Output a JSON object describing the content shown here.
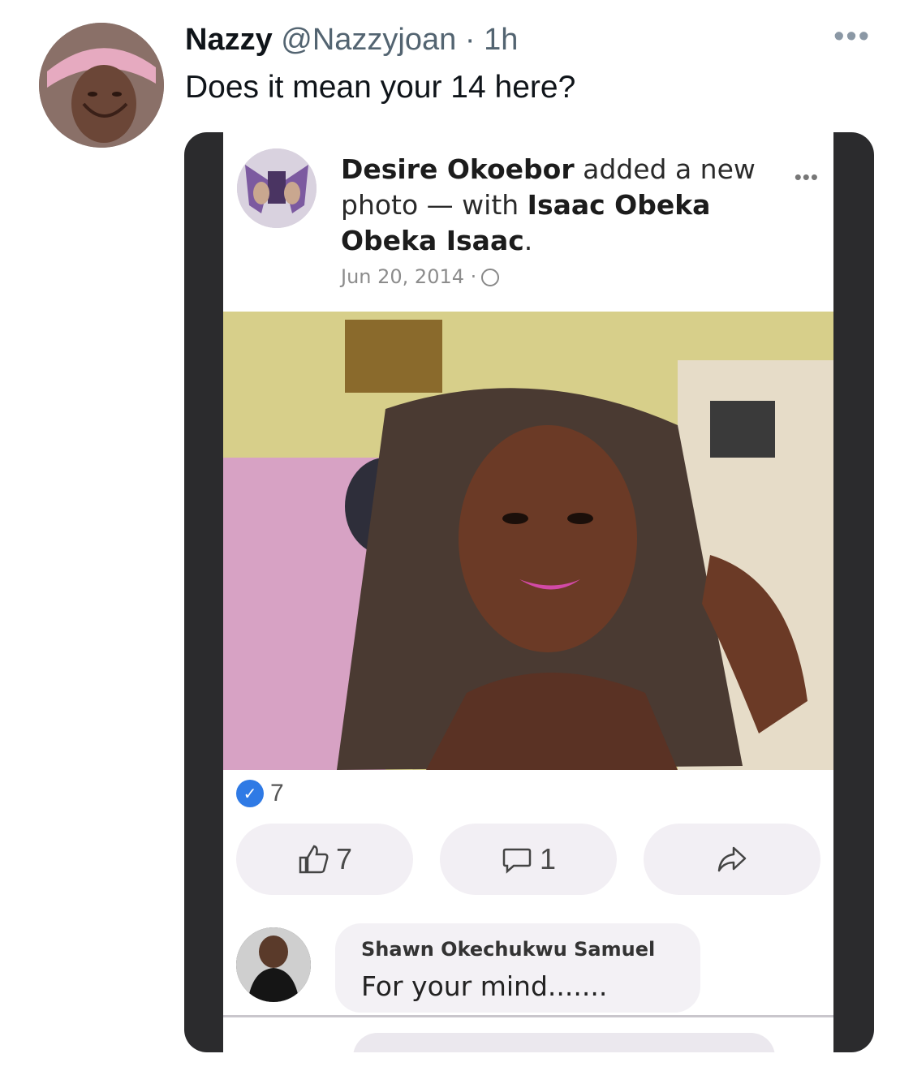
{
  "tweet": {
    "display_name": "Nazzy",
    "handle": "@Nazzyjoan",
    "separator": " · ",
    "time": "1h",
    "more": "•••",
    "text": "Does it mean your 14 here?"
  },
  "facebook_post": {
    "author": "Desire Okoebor",
    "action_text": " added a new photo — with ",
    "tagged": "Isaac Obeka Obeka Isaac",
    "tagged_suffix": ".",
    "date": "Jun 20, 2014 ·",
    "privacy_icon": "globe-icon",
    "more": "•••",
    "reaction_count": "7",
    "like_count": "7",
    "comment_count": "1",
    "comment": {
      "author": "Shawn Okechukwu Samuel",
      "text": "For your mind......."
    }
  }
}
